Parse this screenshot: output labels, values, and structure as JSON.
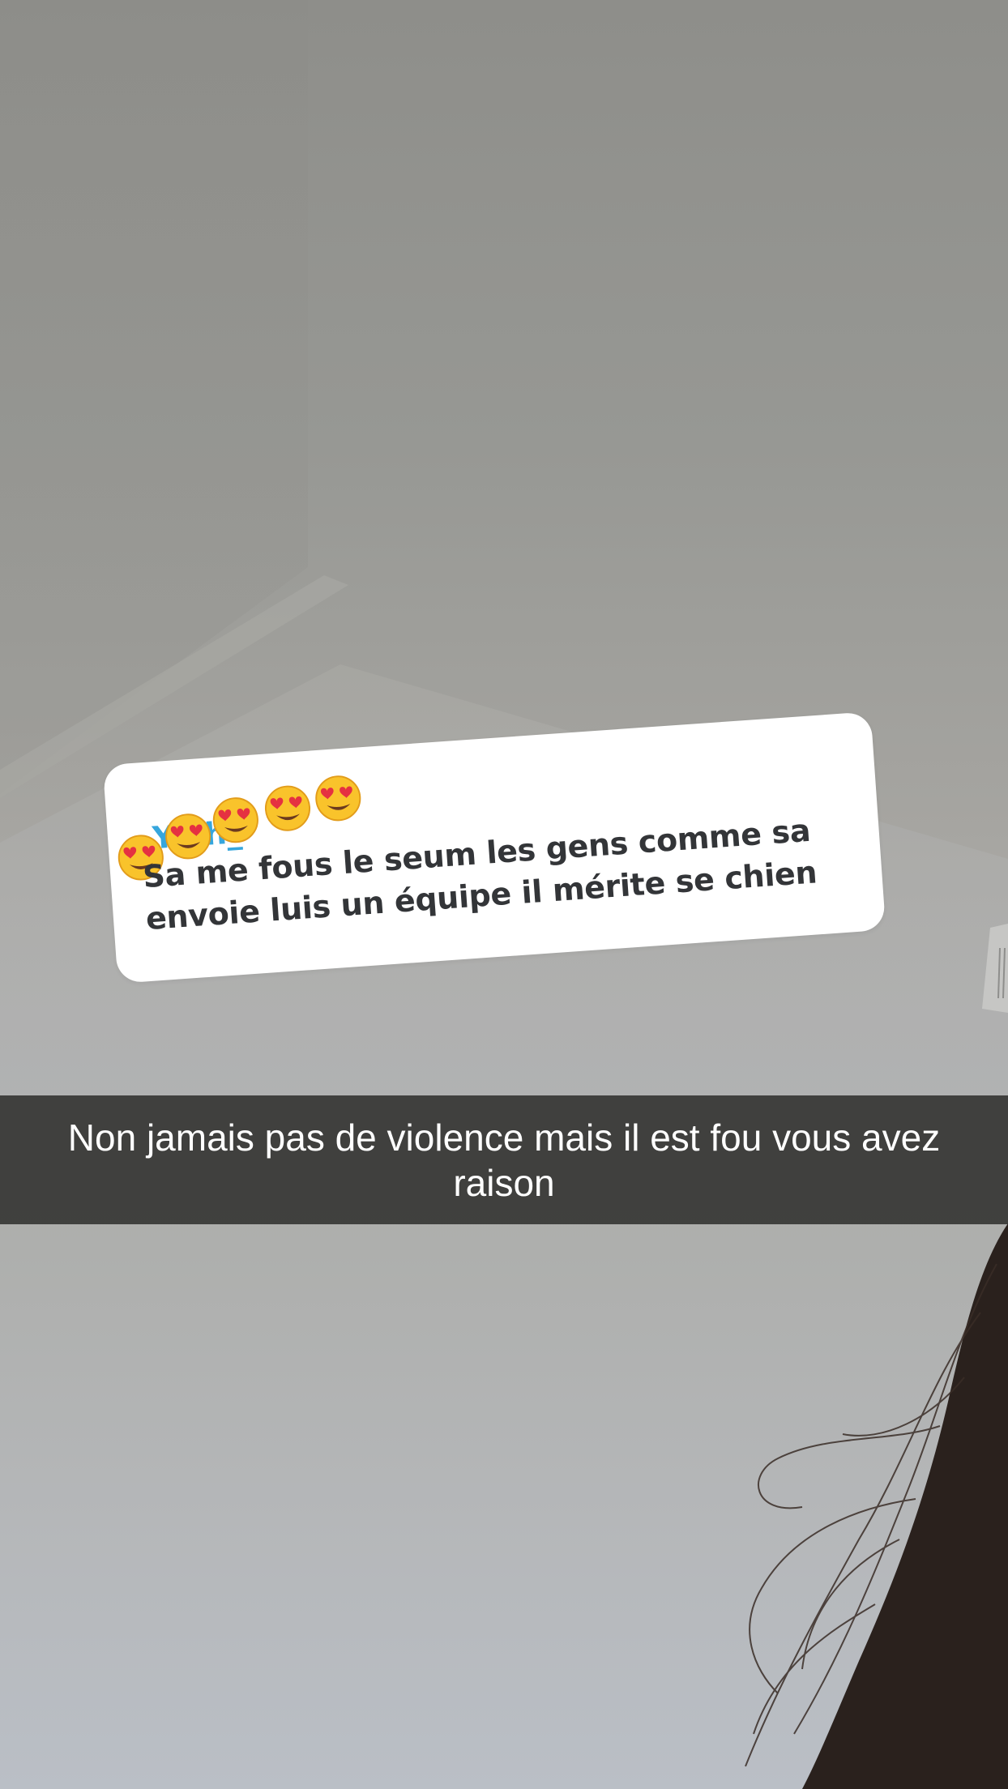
{
  "reply_sticker": {
    "username": "Y...h_",
    "emoji_icon": "heart-eyes-face",
    "emoji_count": 5,
    "message": "Sa me fous le seum les gens comme sa envoie luis un équipe il mérite se chien"
  },
  "caption": {
    "text": "Non jamais pas de violence mais il est fou vous avez raison"
  },
  "colors": {
    "username": "#36a6dd",
    "message_text": "#333538",
    "caption_bar": "#282826",
    "caption_text": "#ffffff"
  }
}
